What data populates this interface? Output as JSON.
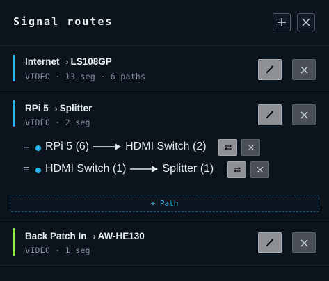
{
  "header": {
    "title": "Signal routes",
    "add_icon": "plus-icon",
    "close_icon": "close-icon"
  },
  "routes": [
    {
      "name": "Internet",
      "dest": "LS108GP",
      "sub": "VIDEO · 13 seg · 6 paths",
      "color": "#23b6f0"
    },
    {
      "name": "RPi 5",
      "dest": "Splitter",
      "sub": "VIDEO · 2 seg",
      "color": "#23b6f0",
      "paths": [
        {
          "from": "RPi 5 (6)",
          "to": "HDMI Switch (2)"
        },
        {
          "from": "HDMI Switch (1)",
          "to": "Splitter (1)"
        }
      ],
      "add_path_label": "+ Path"
    },
    {
      "name": "Back Patch In",
      "dest": "AW-HE130",
      "sub": "VIDEO · 1 seg",
      "color": "#9be63c"
    }
  ],
  "icons": {
    "arrow": "chevron-right-icon",
    "edit": "pencil-icon",
    "delete": "close-icon",
    "swap": "swap-icon",
    "drag": "drag-handle-icon"
  }
}
